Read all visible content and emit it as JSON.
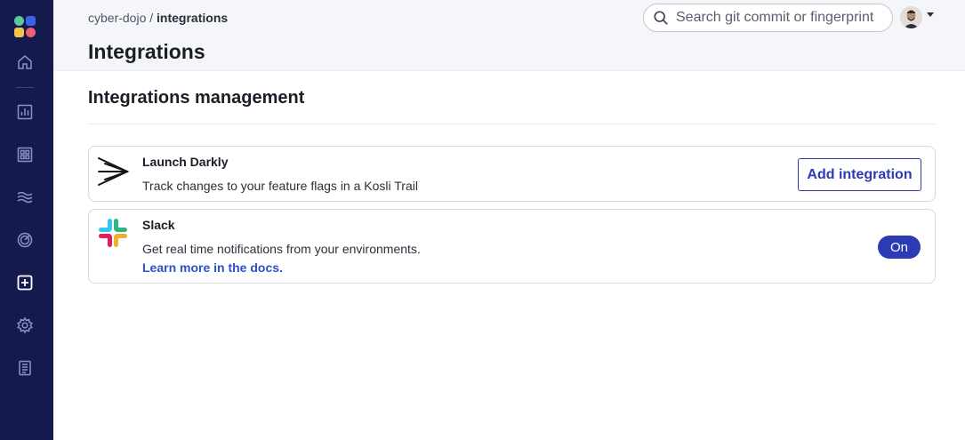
{
  "breadcrumb": {
    "org": "cyber-dojo",
    "separator": "/",
    "current": "integrations"
  },
  "page": {
    "title": "Integrations"
  },
  "search": {
    "placeholder": "Search git commit or fingerprint",
    "value": ""
  },
  "sidebar": {
    "items": [
      {
        "name": "home",
        "icon": "home-icon"
      },
      {
        "name": "dashboard",
        "icon": "bar-chart-icon"
      },
      {
        "name": "environments",
        "icon": "grid-icon"
      },
      {
        "name": "flows",
        "icon": "waves-icon"
      },
      {
        "name": "targets",
        "icon": "target-icon"
      },
      {
        "name": "integrations",
        "icon": "plus-square-icon",
        "active": true
      },
      {
        "name": "settings",
        "icon": "gear-icon"
      },
      {
        "name": "docs",
        "icon": "document-icon"
      }
    ]
  },
  "section": {
    "title": "Integrations management"
  },
  "integrations": [
    {
      "name": "Launch Darkly",
      "description": "Track changes to your feature flags in a Kosli Trail",
      "action_label": "Add integration",
      "icon": "launchdarkly-icon"
    },
    {
      "name": "Slack",
      "description": "Get real time notifications from your environments.",
      "link_label": "Learn more in the docs.",
      "status_label": "On",
      "icon": "slack-icon"
    }
  ],
  "colors": {
    "sidebar_bg": "#151a4e",
    "accent": "#2b3bb3",
    "link": "#2f4fc9",
    "header_bg": "#f5f6fa"
  }
}
